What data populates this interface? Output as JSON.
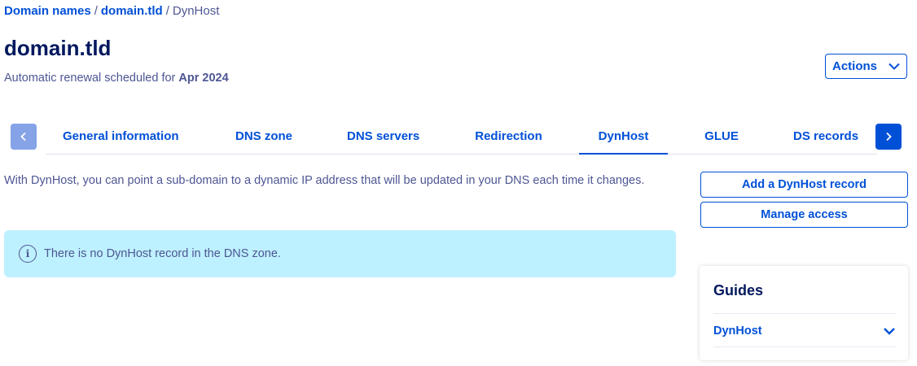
{
  "breadcrumb": {
    "items": [
      "Domain names",
      "domain.tld"
    ],
    "current": "DynHost",
    "separator": "/"
  },
  "header": {
    "title": "domain.tld",
    "subtitle_prefix": "Automatic renewal scheduled for ",
    "subtitle_date": "Apr 2024",
    "actions_label": "Actions"
  },
  "tabs": [
    {
      "label": "General information",
      "active": false
    },
    {
      "label": "DNS zone",
      "active": false
    },
    {
      "label": "DNS servers",
      "active": false
    },
    {
      "label": "Redirection",
      "active": false
    },
    {
      "label": "DynHost",
      "active": true
    },
    {
      "label": "GLUE",
      "active": false
    },
    {
      "label": "DS records",
      "active": false
    }
  ],
  "main": {
    "intro": "With DynHost, you can point a sub-domain to a dynamic IP address that will be updated in your DNS each time it changes.",
    "info_message": "There is no DynHost record in the DNS zone."
  },
  "sidebar": {
    "add_button": "Add a DynHost record",
    "manage_button": "Manage access",
    "guides_title": "Guides",
    "guides_items": [
      "DynHost"
    ]
  },
  "colors": {
    "accent": "#0050d7",
    "info_background": "#bef1ff",
    "text": "#4d5693",
    "title": "#00185e"
  },
  "icons": {
    "actions": "chevron-down-icon",
    "tabs_prev": "chevron-left-icon",
    "tabs_next": "chevron-right-icon",
    "info": "info-icon",
    "guide_expand": "chevron-down-icon"
  }
}
